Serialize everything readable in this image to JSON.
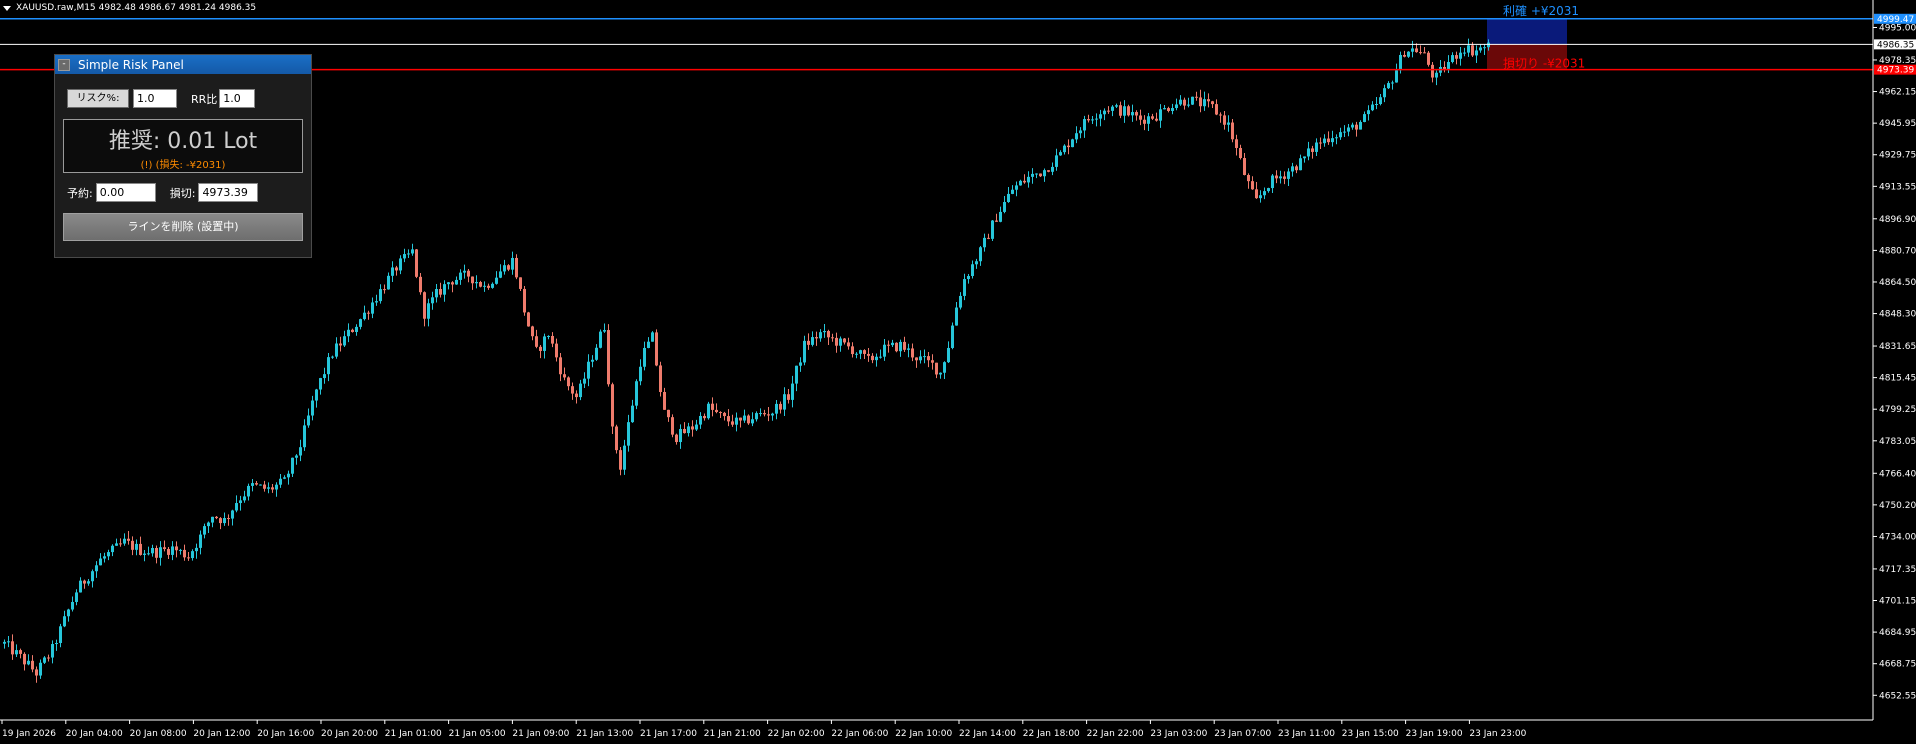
{
  "symbol": {
    "name": "XAUUSD.raw,M15",
    "ohlc": "4982.48 4986.67 4981.24 4986.35"
  },
  "panel": {
    "title": "Simple Risk Panel",
    "minimize_label": "-",
    "risk_button": "リスク%:",
    "risk_value": "1.0",
    "rr_label": "RR比",
    "rr_value": "1.0",
    "recommend_text": "推奨: 0.01 Lot",
    "warning_text": "(!) (損失: -¥2031)",
    "entry_label": "予約:",
    "entry_value": "0.00",
    "sl_label": "損切:",
    "sl_value": "4973.39",
    "delete_button": "ラインを削除 (設置中)"
  },
  "lines": {
    "tp_label": "利確 +¥2031",
    "sl_label": "損切り -¥2031",
    "tp_price": "4999.47",
    "current_price": "4986.35",
    "sl_price": "4973.39"
  },
  "colors": {
    "bull": "#26c6da",
    "bear": "#ef7b6c",
    "tp_line": "#1e90ff",
    "sl_line": "#ff0000",
    "current_line": "#ffffff",
    "tp_zone": "#0a1a7a",
    "sl_zone": "#6a0808",
    "axis_text": "#ffffff"
  },
  "chart_data": {
    "type": "candlestick",
    "ylim": [
      4645.0,
      5005.0
    ],
    "y_ticks": [
      "4995.00",
      "4978.35",
      "4962.15",
      "4945.95",
      "4929.75",
      "4913.55",
      "4896.90",
      "4880.70",
      "4864.50",
      "4848.30",
      "4831.65",
      "4815.45",
      "4799.25",
      "4783.05",
      "4766.40",
      "4750.20",
      "4734.00",
      "4717.35",
      "4701.15",
      "4684.95",
      "4668.75",
      "4652.55"
    ],
    "x_ticks": [
      "19 Jan 2026",
      "20 Jan 04:00",
      "20 Jan 08:00",
      "20 Jan 12:00",
      "20 Jan 16:00",
      "20 Jan 20:00",
      "21 Jan 01:00",
      "21 Jan 05:00",
      "21 Jan 09:00",
      "21 Jan 13:00",
      "21 Jan 17:00",
      "21 Jan 21:00",
      "22 Jan 02:00",
      "22 Jan 06:00",
      "22 Jan 10:00",
      "22 Jan 14:00",
      "22 Jan 18:00",
      "22 Jan 22:00",
      "23 Jan 03:00",
      "23 Jan 07:00",
      "23 Jan 11:00",
      "23 Jan 15:00",
      "23 Jan 19:00",
      "23 Jan 23:00"
    ],
    "close_path": [
      [
        0,
        4679
      ],
      [
        10,
        4672
      ],
      [
        20,
        4664
      ],
      [
        30,
        4676
      ],
      [
        45,
        4706
      ],
      [
        60,
        4722
      ],
      [
        75,
        4731
      ],
      [
        85,
        4727
      ],
      [
        95,
        4726
      ],
      [
        105,
        4728
      ],
      [
        115,
        4724
      ],
      [
        122,
        4733
      ],
      [
        130,
        4745
      ],
      [
        138,
        4742
      ],
      [
        145,
        4752
      ],
      [
        155,
        4760
      ],
      [
        165,
        4758
      ],
      [
        175,
        4762
      ],
      [
        185,
        4781
      ],
      [
        195,
        4809
      ],
      [
        205,
        4828
      ],
      [
        215,
        4838
      ],
      [
        225,
        4848
      ],
      [
        235,
        4860
      ],
      [
        245,
        4872
      ],
      [
        255,
        4880
      ],
      [
        262,
        4848
      ],
      [
        270,
        4858
      ],
      [
        278,
        4865
      ],
      [
        290,
        4868
      ],
      [
        300,
        4862
      ],
      [
        310,
        4870
      ],
      [
        318,
        4876
      ],
      [
        325,
        4850
      ],
      [
        332,
        4828
      ],
      [
        340,
        4838
      ],
      [
        350,
        4814
      ],
      [
        358,
        4805
      ],
      [
        368,
        4828
      ],
      [
        375,
        4842
      ],
      [
        380,
        4788
      ],
      [
        385,
        4770
      ],
      [
        392,
        4800
      ],
      [
        398,
        4826
      ],
      [
        405,
        4836
      ],
      [
        412,
        4798
      ],
      [
        420,
        4785
      ],
      [
        430,
        4790
      ],
      [
        440,
        4800
      ],
      [
        450,
        4794
      ],
      [
        460,
        4792
      ],
      [
        470,
        4796
      ],
      [
        480,
        4798
      ],
      [
        490,
        4806
      ],
      [
        500,
        4832
      ],
      [
        510,
        4838
      ],
      [
        520,
        4834
      ],
      [
        530,
        4830
      ],
      [
        540,
        4824
      ],
      [
        550,
        4830
      ],
      [
        560,
        4832
      ],
      [
        570,
        4826
      ],
      [
        580,
        4822
      ],
      [
        585,
        4818
      ],
      [
        590,
        4832
      ],
      [
        595,
        4852
      ],
      [
        600,
        4866
      ],
      [
        610,
        4880
      ],
      [
        620,
        4898
      ],
      [
        630,
        4912
      ],
      [
        640,
        4918
      ],
      [
        650,
        4922
      ],
      [
        660,
        4930
      ],
      [
        670,
        4942
      ],
      [
        680,
        4950
      ],
      [
        690,
        4954
      ],
      [
        700,
        4952
      ],
      [
        710,
        4948
      ],
      [
        720,
        4950
      ],
      [
        730,
        4956
      ],
      [
        740,
        4958
      ],
      [
        748,
        4956
      ],
      [
        755,
        4954
      ],
      [
        765,
        4945
      ],
      [
        775,
        4920
      ],
      [
        782,
        4905
      ],
      [
        790,
        4915
      ],
      [
        800,
        4920
      ],
      [
        810,
        4926
      ],
      [
        820,
        4935
      ],
      [
        830,
        4940
      ],
      [
        840,
        4942
      ],
      [
        850,
        4948
      ],
      [
        860,
        4958
      ],
      [
        868,
        4970
      ],
      [
        875,
        4983
      ],
      [
        882,
        4984
      ],
      [
        888,
        4980
      ],
      [
        894,
        4968
      ],
      [
        900,
        4975
      ],
      [
        906,
        4980
      ],
      [
        912,
        4985
      ],
      [
        918,
        4983
      ],
      [
        925,
        4985
      ],
      [
        930,
        4986
      ]
    ]
  }
}
